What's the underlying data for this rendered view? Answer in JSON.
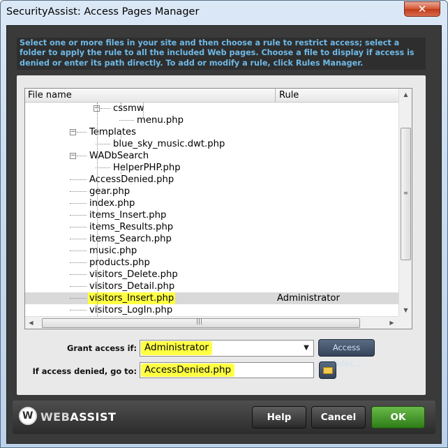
{
  "window": {
    "title": "SecurityAssist: Access Pages Manager",
    "close_glyph": "✕"
  },
  "instructions": "Select one or more files in your site and then choose a rule to restrict access; select a folder to apply the rule to all the included Web pages. Choose a file to display if access is denied or enter its path directly. To add or modify a rule, click Rules Manager.",
  "tree": {
    "columns": {
      "file": "File name",
      "rule": "Rule"
    },
    "rows": [
      {
        "name": "cssmw",
        "rule": "",
        "type": "folder"
      },
      {
        "name": "menu.php",
        "rule": "",
        "type": "file"
      },
      {
        "name": "Templates",
        "rule": "",
        "type": "folder"
      },
      {
        "name": "blue_sky_music.dwt.php",
        "rule": "",
        "type": "file"
      },
      {
        "name": "WADbSearch",
        "rule": "",
        "type": "folder"
      },
      {
        "name": "HelperPHP.php",
        "rule": "",
        "type": "file"
      },
      {
        "name": "AccessDenied.php",
        "rule": "",
        "type": "file"
      },
      {
        "name": "gear.php",
        "rule": "",
        "type": "file"
      },
      {
        "name": "index.php",
        "rule": "",
        "type": "file"
      },
      {
        "name": "items_Insert.php",
        "rule": "",
        "type": "file"
      },
      {
        "name": "items_Results.php",
        "rule": "",
        "type": "file"
      },
      {
        "name": "items_Search.php",
        "rule": "",
        "type": "file"
      },
      {
        "name": "music.php",
        "rule": "",
        "type": "file"
      },
      {
        "name": "products.php",
        "rule": "",
        "type": "file"
      },
      {
        "name": "visitors_Delete.php",
        "rule": "",
        "type": "file"
      },
      {
        "name": "visitors_Detail.php",
        "rule": "",
        "type": "file"
      },
      {
        "name": "visitors_Insert.php",
        "rule": "Administrator",
        "type": "file",
        "selected": true
      },
      {
        "name": "visitors_LogIn.php",
        "rule": "",
        "type": "file"
      }
    ]
  },
  "form": {
    "grant_label": "Grant access if:",
    "grant_value": "Administrator",
    "access_rules_button": "Access Rules...",
    "denied_label": "If access denied, go to:",
    "denied_value": "AccessDenied.php"
  },
  "footer": {
    "logo_mark": "W",
    "logo_web": "WEB",
    "logo_assist": "ASSIST",
    "help": "Help",
    "cancel": "Cancel",
    "ok": "OK"
  },
  "colors": {
    "highlight": "#ffff44",
    "ok_green": "#3a8f1f",
    "instructions_text": "#6fb9e6"
  }
}
